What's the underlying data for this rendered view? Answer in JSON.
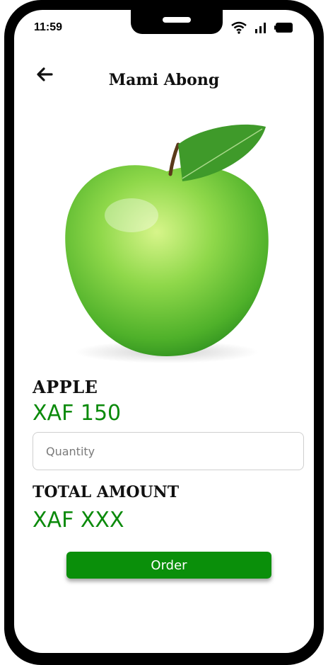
{
  "status": {
    "time": "11:59",
    "icons": [
      "wifi-icon",
      "signal-icon",
      "battery-icon"
    ]
  },
  "header": {
    "title": "Mami Abong",
    "back_icon": "arrow-left-icon"
  },
  "product": {
    "name": "APPLE",
    "price": "XAF 150",
    "image_icon": "green-apple-image"
  },
  "form": {
    "quantity_placeholder": "Quantity",
    "quantity_value": ""
  },
  "total": {
    "label": "TOTAL AMOUNT",
    "value": "XAF XXX"
  },
  "actions": {
    "order_label": "Order"
  },
  "colors": {
    "accent_green": "#0a8f0a",
    "price_green": "#0b8a0b",
    "frame": "#000000"
  }
}
